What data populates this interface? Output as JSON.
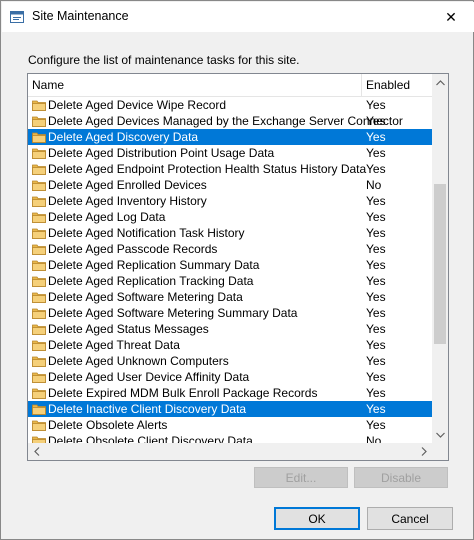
{
  "window": {
    "title": "Site Maintenance",
    "close_glyph": "✕",
    "icon": "window-app-icon"
  },
  "instructions": "Configure the list of maintenance tasks for this site.",
  "list": {
    "columns": {
      "name": "Name",
      "enabled": "Enabled"
    },
    "rows": [
      {
        "name": "Delete Aged Device Wipe Record",
        "enabled": "Yes",
        "selected": false
      },
      {
        "name": "Delete Aged Devices Managed by the Exchange Server Connector",
        "enabled": "Yes",
        "selected": false
      },
      {
        "name": "Delete Aged Discovery Data",
        "enabled": "Yes",
        "selected": true
      },
      {
        "name": "Delete Aged Distribution Point Usage Data",
        "enabled": "Yes",
        "selected": false
      },
      {
        "name": "Delete Aged Endpoint Protection Health Status History Data",
        "enabled": "Yes",
        "selected": false
      },
      {
        "name": "Delete Aged Enrolled Devices",
        "enabled": "No",
        "selected": false
      },
      {
        "name": "Delete Aged Inventory History",
        "enabled": "Yes",
        "selected": false
      },
      {
        "name": "Delete Aged Log Data",
        "enabled": "Yes",
        "selected": false
      },
      {
        "name": "Delete Aged Notification Task History",
        "enabled": "Yes",
        "selected": false
      },
      {
        "name": "Delete Aged Passcode Records",
        "enabled": "Yes",
        "selected": false
      },
      {
        "name": "Delete Aged Replication Summary Data",
        "enabled": "Yes",
        "selected": false
      },
      {
        "name": "Delete Aged Replication Tracking Data",
        "enabled": "Yes",
        "selected": false
      },
      {
        "name": "Delete Aged Software Metering Data",
        "enabled": "Yes",
        "selected": false
      },
      {
        "name": "Delete Aged Software Metering Summary Data",
        "enabled": "Yes",
        "selected": false
      },
      {
        "name": "Delete Aged Status Messages",
        "enabled": "Yes",
        "selected": false
      },
      {
        "name": "Delete Aged Threat Data",
        "enabled": "Yes",
        "selected": false
      },
      {
        "name": "Delete Aged Unknown Computers",
        "enabled": "Yes",
        "selected": false
      },
      {
        "name": "Delete Aged User Device Affinity Data",
        "enabled": "Yes",
        "selected": false
      },
      {
        "name": "Delete Expired MDM Bulk Enroll Package Records",
        "enabled": "Yes",
        "selected": false
      },
      {
        "name": "Delete Inactive Client Discovery Data",
        "enabled": "Yes",
        "selected": true
      },
      {
        "name": "Delete Obsolete Alerts",
        "enabled": "Yes",
        "selected": false
      },
      {
        "name": "Delete Obsolete Client Discovery Data",
        "enabled": "No",
        "selected": false
      }
    ]
  },
  "buttons": {
    "edit": "Edit...",
    "disable": "Disable",
    "ok": "OK",
    "cancel": "Cancel"
  },
  "colors": {
    "selection": "#0078d7",
    "folder": "#e8b74a"
  }
}
